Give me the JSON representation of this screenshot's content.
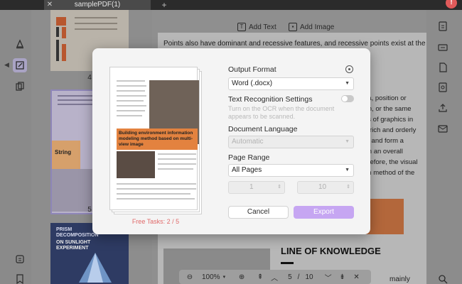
{
  "tabbar": {
    "tab_title": "samplePDF(1)",
    "close": "✕",
    "new_tab": "+",
    "notification": "!"
  },
  "thumbnails": {
    "pages": [
      {
        "number": "4"
      },
      {
        "number": "5"
      }
    ],
    "page6_title": "PRISM DECOMPOSITION",
    "page6_subtitle": "ON SUNLIGHT EXPERIMENT"
  },
  "doc_toolbar": {
    "add_text": "Add Text",
    "add_image": "Add Image"
  },
  "document": {
    "top_line": "Points also have dominant and recessive features, and recessive points exist at the",
    "right_fragments": [
      "ea, position or",
      "rm, or the same",
      "ds of graphics in",
      "e rich and orderly",
      "rs and form a",
      "rm an overall",
      "erefore, the visual",
      "on method of the"
    ],
    "heading": "LINE OF KNOWLEDGE",
    "bottom_fragment": "mainly"
  },
  "page_nav": {
    "zoom": "100%",
    "current_page": "5",
    "separator": "/",
    "total_pages": "10"
  },
  "modal": {
    "output_format_label": "Output Format",
    "output_format_value": "Word (.docx)",
    "text_recognition_label": "Text Recognition Settings",
    "ocr_hint": "Turn on the OCR when the document appears to be scanned.",
    "document_language_label": "Document Language",
    "document_language_value": "Automatic",
    "page_range_label": "Page Range",
    "page_range_value": "All Pages",
    "range_from": "1",
    "range_to": "10",
    "range_dash": "—",
    "cancel": "Cancel",
    "export": "Export",
    "free_tasks": "Free Tasks: 2 / 5",
    "preview_heading": "Building environment information modeling method based on multi-view image",
    "preview_band": "String"
  },
  "colors": {
    "accent": "#c6a6f2",
    "orange": "#e3823f",
    "free_tasks_red": "#e06a6a"
  }
}
